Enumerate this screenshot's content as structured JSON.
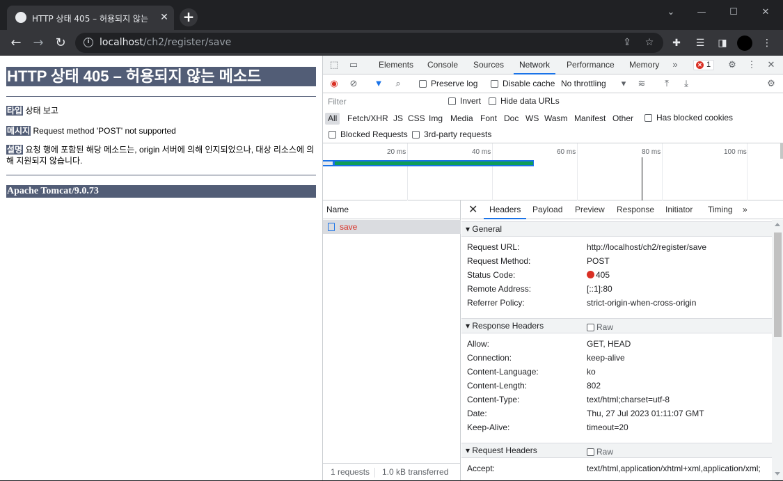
{
  "browser": {
    "tab_title": "HTTP 상태 405 – 허용되지 않는",
    "tab_icon": "globe-icon",
    "url_host": "localhost",
    "url_path": "/ch2/register/save"
  },
  "page": {
    "heading": "HTTP 상태 405 – 허용되지 않는 메소드",
    "type_label": "타입",
    "type_value": "상태 보고",
    "message_label": "메시지",
    "message_value": "Request method 'POST' not supported",
    "description_label": "설명",
    "description_value": "요청 행에 포함된 해당 메소드는, origin 서버에 의해 인지되었으나, 대상 리소스에 의해 지원되지 않습니다.",
    "footer": "Apache Tomcat/9.0.73"
  },
  "devtools": {
    "tabs": [
      "Elements",
      "Console",
      "Sources",
      "Network",
      "Performance",
      "Memory"
    ],
    "active_tab": "Network",
    "error_count": "1",
    "toolbar": {
      "preserve_log": "Preserve log",
      "disable_cache": "Disable cache",
      "throttling": "No throttling"
    },
    "filter": {
      "placeholder": "Filter",
      "invert": "Invert",
      "hide_data_urls": "Hide data URLs",
      "types": [
        "All",
        "Fetch/XHR",
        "JS",
        "CSS",
        "Img",
        "Media",
        "Font",
        "Doc",
        "WS",
        "Wasm",
        "Manifest",
        "Other"
      ],
      "has_blocked_cookies": "Has blocked cookies",
      "blocked_requests": "Blocked Requests",
      "third_party": "3rd-party requests"
    },
    "overview_ticks": [
      "20 ms",
      "40 ms",
      "60 ms",
      "80 ms",
      "100 ms"
    ],
    "request_list": {
      "header": "Name",
      "items": [
        {
          "name": "save"
        }
      ],
      "status_requests": "1 requests",
      "status_transferred": "1.0 kB transferred"
    },
    "detail": {
      "tabs": [
        "Headers",
        "Payload",
        "Preview",
        "Response",
        "Initiator",
        "Timing"
      ],
      "active_tab": "Headers",
      "general": {
        "title": "General",
        "rows": [
          {
            "key": "Request URL:",
            "value": "http://localhost/ch2/register/save"
          },
          {
            "key": "Request Method:",
            "value": "POST"
          },
          {
            "key": "Status Code:",
            "value": "405"
          },
          {
            "key": "Remote Address:",
            "value": "[::1]:80"
          },
          {
            "key": "Referrer Policy:",
            "value": "strict-origin-when-cross-origin"
          }
        ]
      },
      "response_headers": {
        "title": "Response Headers",
        "raw": "Raw",
        "rows": [
          {
            "key": "Allow:",
            "value": "GET, HEAD"
          },
          {
            "key": "Connection:",
            "value": "keep-alive"
          },
          {
            "key": "Content-Language:",
            "value": "ko"
          },
          {
            "key": "Content-Length:",
            "value": "802"
          },
          {
            "key": "Content-Type:",
            "value": "text/html;charset=utf-8"
          },
          {
            "key": "Date:",
            "value": "Thu, 27 Jul 2023 01:11:07 GMT"
          },
          {
            "key": "Keep-Alive:",
            "value": "timeout=20"
          }
        ]
      },
      "request_headers": {
        "title": "Request Headers",
        "raw": "Raw",
        "rows": [
          {
            "key": "Accept:",
            "value": "text/html,application/xhtml+xml,application/xml;"
          }
        ]
      }
    }
  },
  "colors": {
    "tomcat_bar": "#525d76",
    "status_error": "#d93025",
    "devtools_accent": "#1a73e8"
  }
}
